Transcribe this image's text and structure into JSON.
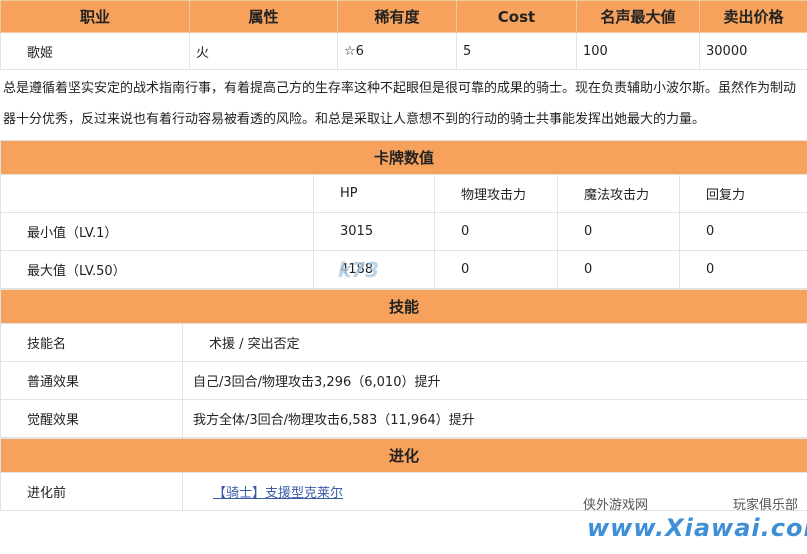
{
  "info_table": {
    "headers": [
      "职业",
      "属性",
      "稀有度",
      "Cost",
      "名声最大値",
      "卖出价格"
    ],
    "row": [
      "歌姬",
      "火",
      "☆6",
      "5",
      "100",
      "30000"
    ]
  },
  "description": "总是遵循着坚实安定的战术指南行事，有着提高己方的生存率这种不起眼但是很可靠的成果的骑士。现在负责辅助小波尔斯。虽然作为制动器十分优秀，反过来说也有着行动容易被看透的风险。和总是采取让人意想不到的行动的骑士共事能发挥出她最大的力量。",
  "stats": {
    "title": "卡牌数值",
    "headers": [
      "",
      "HP",
      "物理攻击力",
      "魔法攻击力",
      "回复力"
    ],
    "rows": [
      [
        "最小值（LV.1）",
        "3015",
        "0",
        "0",
        "0"
      ],
      [
        "最大值（LV.50）",
        "4188",
        "0",
        "0",
        "0"
      ]
    ]
  },
  "skill": {
    "title": "技能",
    "rows": [
      {
        "label": "技能名",
        "value": "术援 / 突出否定"
      },
      {
        "label": "普通效果",
        "value": "自己/3回合/物理攻击3,296（6,010）提升"
      },
      {
        "label": "觉醒效果",
        "value": "我方全体/3回合/物理攻击6,583（11,964）提升"
      }
    ]
  },
  "evolution": {
    "title": "进化",
    "label": "进化前",
    "link_text": "【骑士】支援型克莱尔"
  },
  "watermarks": {
    "k73": "k73",
    "xiawai_left": "侠外游戏网",
    "xiawai_right": "玩家俱乐部",
    "xiawai_url": "www.Xiawai.com"
  }
}
